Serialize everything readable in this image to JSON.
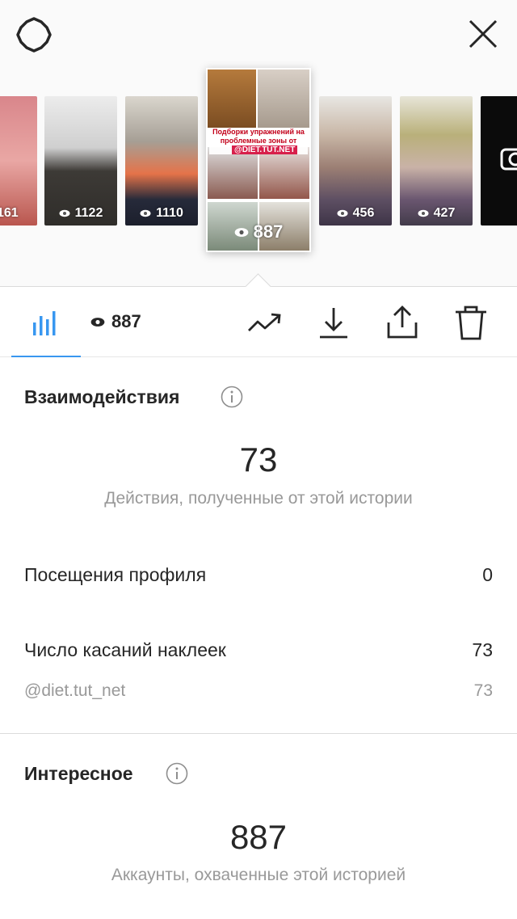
{
  "header": {
    "settings_icon": "gear-icon",
    "close_icon": "close-icon"
  },
  "stories": [
    {
      "views": "161"
    },
    {
      "views": "1122"
    },
    {
      "views": "1110"
    },
    {
      "views": "887",
      "selected": true,
      "caption": "Подборки упражнений на проблемные зоны от Марины",
      "handle": "@DIET.TUT.NET"
    },
    {
      "views": "456"
    },
    {
      "views": "427"
    },
    {
      "views": ""
    }
  ],
  "toolbar": {
    "insights_icon": "bar-chart-icon",
    "views": "887",
    "promote_icon": "trending-up-icon",
    "download_icon": "download-icon",
    "share_icon": "share-icon",
    "delete_icon": "trash-icon"
  },
  "interactions": {
    "title": "Взаимодействия",
    "total": "73",
    "subtitle": "Действия, полученные от этой истории",
    "rows": [
      {
        "label": "Посещения профиля",
        "value": "0"
      },
      {
        "label": "Число касаний наклеек",
        "value": "73"
      },
      {
        "label": "@diet.tut_net",
        "value": "73"
      }
    ]
  },
  "discovery": {
    "title": "Интересное",
    "total": "887",
    "subtitle": "Аккаунты, охваченные этой историей"
  },
  "colors": {
    "accent": "#3897f0",
    "text": "#262626",
    "muted": "#999999"
  }
}
